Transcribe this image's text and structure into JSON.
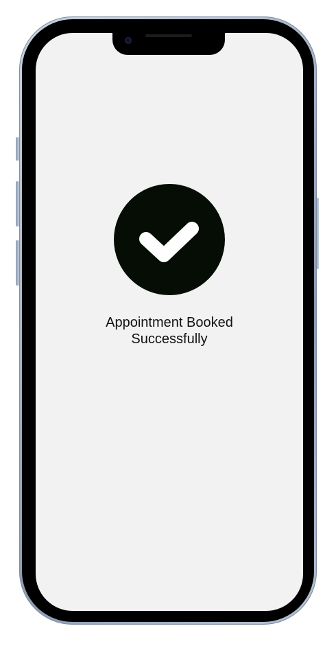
{
  "confirmation": {
    "message_line1": "Appointment Booked",
    "message_line2": "Successfully",
    "icon": "checkmark-icon",
    "icon_background": "#050d05",
    "icon_foreground": "#ffffff"
  },
  "device": {
    "frame": "phone",
    "screen_background": "#f2f2f2"
  }
}
